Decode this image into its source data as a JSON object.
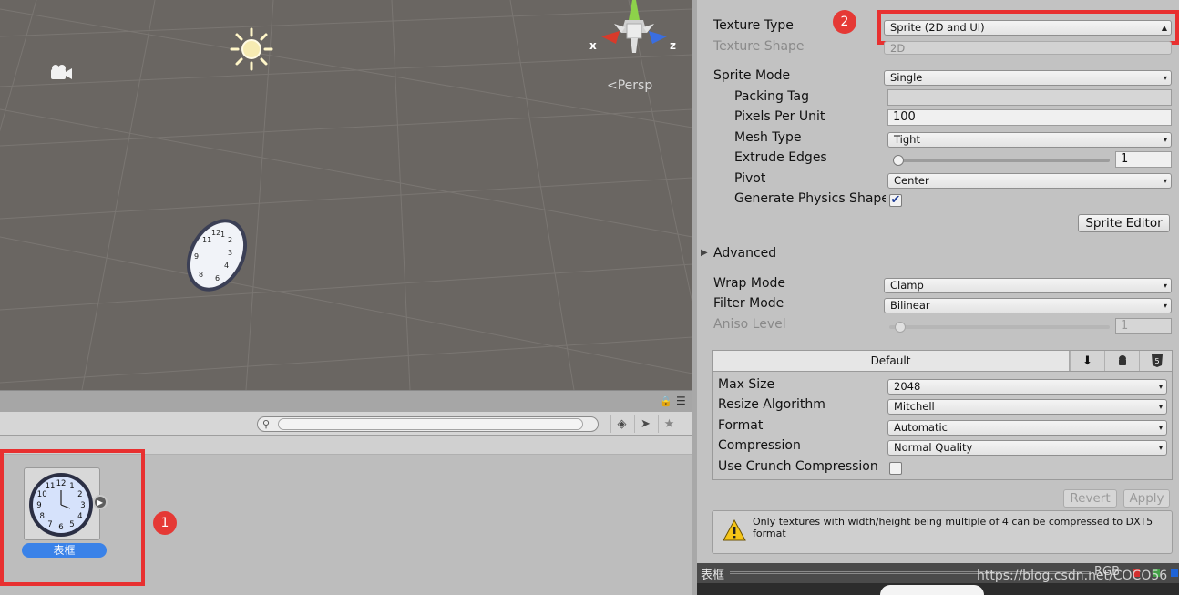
{
  "scene": {
    "persp_label": "Persp",
    "axis_x": "x",
    "axis_z": "z",
    "icons": [
      "camera-icon",
      "sun-light-icon",
      "scene-gizmo-icon"
    ]
  },
  "project": {
    "search_placeholder": "",
    "asset_name": "表框",
    "clock_numbers": [
      "12",
      "1",
      "2",
      "3",
      "4",
      "5",
      "6",
      "7",
      "8",
      "9",
      "10",
      "11"
    ]
  },
  "inspector": {
    "texture_type_label": "Texture Type",
    "texture_type_value": "Sprite (2D and UI)",
    "texture_shape_label": "Texture Shape",
    "texture_shape_value": "2D",
    "sprite_mode_label": "Sprite Mode",
    "sprite_mode_value": "Single",
    "packing_tag_label": "Packing Tag",
    "packing_tag_value": "",
    "ppu_label": "Pixels Per Unit",
    "ppu_value": "100",
    "mesh_type_label": "Mesh Type",
    "mesh_type_value": "Tight",
    "extrude_label": "Extrude Edges",
    "extrude_value": "1",
    "pivot_label": "Pivot",
    "pivot_value": "Center",
    "physics_shape_label": "Generate Physics Shape",
    "physics_shape_checked": true,
    "sprite_editor_label": "Sprite Editor",
    "advanced_label": "Advanced",
    "wrap_mode_label": "Wrap Mode",
    "wrap_mode_value": "Clamp",
    "filter_mode_label": "Filter Mode",
    "filter_mode_value": "Bilinear",
    "aniso_label": "Aniso Level",
    "aniso_value": "1",
    "platform_default_tab": "Default",
    "max_size_label": "Max Size",
    "max_size_value": "2048",
    "resize_label": "Resize Algorithm",
    "resize_value": "Mitchell",
    "format_label": "Format",
    "format_value": "Automatic",
    "compression_label": "Compression",
    "compression_value": "Normal Quality",
    "crunch_label": "Use Crunch Compression",
    "crunch_checked": false,
    "revert_label": "Revert",
    "apply_label": "Apply",
    "help_text": "Only textures with width/height being multiple of 4 can be compressed to DXT5 format"
  },
  "preview": {
    "title": "表框",
    "rgb_label": "RGB"
  },
  "annotations": {
    "badge_1": "1",
    "badge_2": "2",
    "highlight_color": "#e83030"
  },
  "watermark": "https://blog.csdn.net/COCO56"
}
